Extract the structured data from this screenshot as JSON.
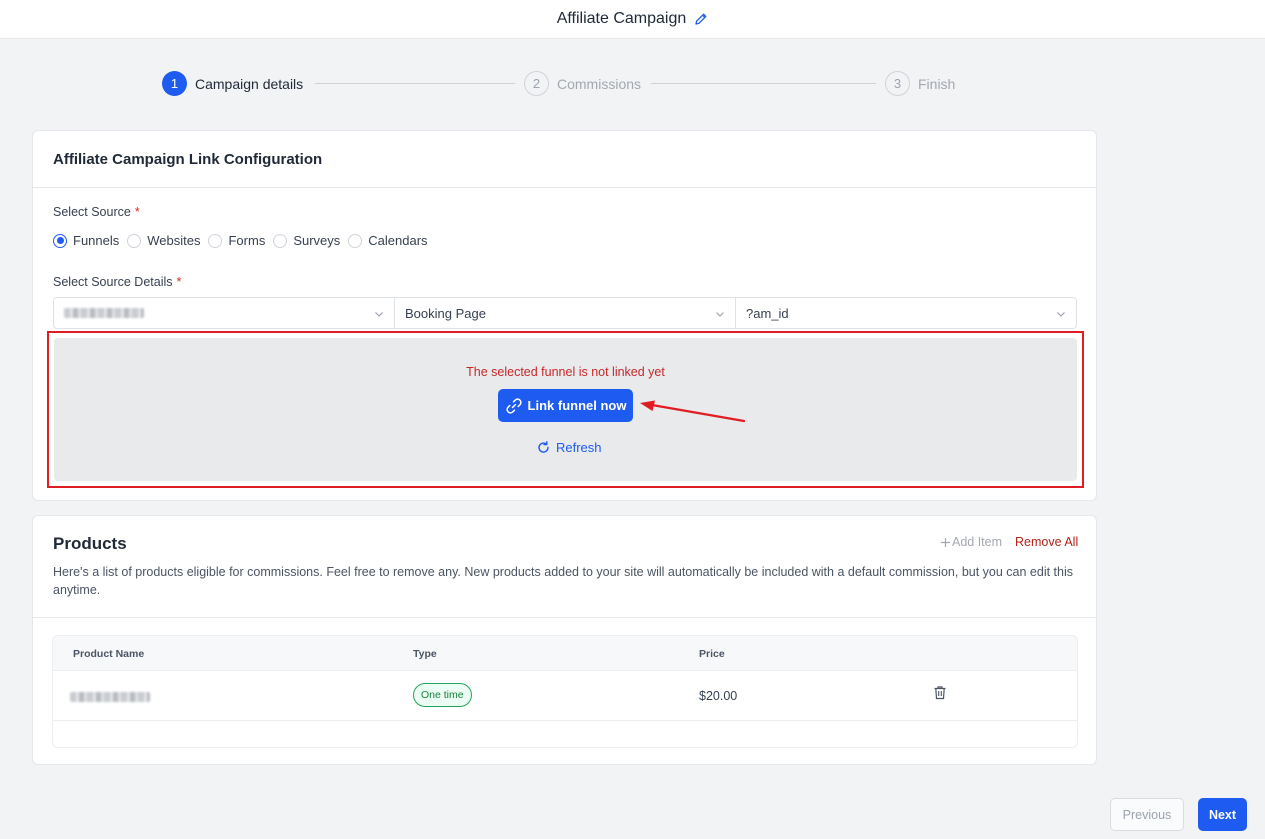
{
  "header": {
    "title": "Affiliate Campaign",
    "edit_icon": "pencil-icon"
  },
  "stepper": {
    "steps": [
      {
        "number": "1",
        "label": "Campaign details",
        "state": "active"
      },
      {
        "number": "2",
        "label": "Commissions",
        "state": "inactive"
      },
      {
        "number": "3",
        "label": "Finish",
        "state": "inactive"
      }
    ]
  },
  "link_config": {
    "title": "Affiliate Campaign Link Configuration",
    "source_label": "Select Source",
    "required_mark": "*",
    "sources": [
      {
        "label": "Funnels",
        "checked": true
      },
      {
        "label": "Websites",
        "checked": false
      },
      {
        "label": "Forms",
        "checked": false
      },
      {
        "label": "Surveys",
        "checked": false
      },
      {
        "label": "Calendars",
        "checked": false
      }
    ],
    "details_label": "Select Source Details",
    "selects": {
      "funnel": "",
      "page": "Booking Page",
      "param": "?am_id"
    },
    "warning": "The selected funnel is not linked yet",
    "link_button": "Link funnel now",
    "refresh": "Refresh"
  },
  "products": {
    "title": "Products",
    "add_item": "Add Item",
    "remove_all": "Remove All",
    "description": "Here's a list of products eligible for commissions. Feel free to remove any. New products added to your site will automatically be included with a default commission, but you can edit this anytime.",
    "columns": [
      "Product Name",
      "Type",
      "Price"
    ],
    "rows": [
      {
        "name": "",
        "type": "One time",
        "price": "$20.00"
      }
    ]
  },
  "footer": {
    "previous": "Previous",
    "next": "Next"
  },
  "colors": {
    "accent": "#1e5bf0",
    "danger": "#e11d24",
    "success": "#22a55a"
  }
}
